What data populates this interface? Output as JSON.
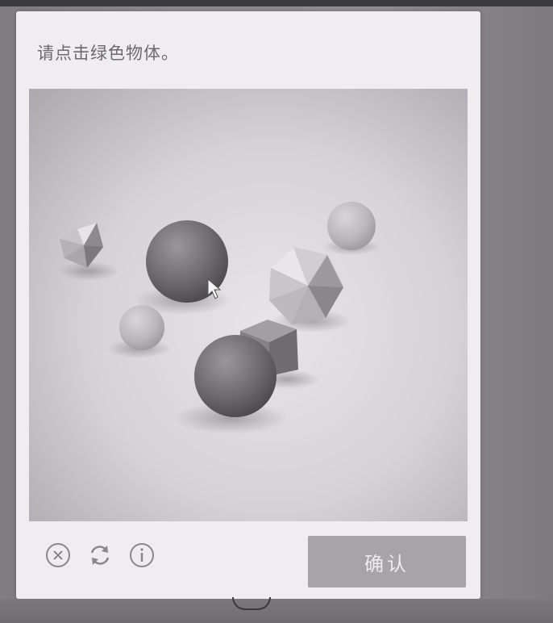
{
  "captcha": {
    "prompt": "请点击绿色物体。",
    "confirm_label": "确认"
  },
  "controls": {
    "close_icon": "close-circle-icon",
    "refresh_icon": "refresh-icon",
    "info_icon": "info-icon"
  },
  "scene": {
    "objects": [
      {
        "shape": "icosahedron",
        "size": "small"
      },
      {
        "shape": "sphere",
        "size": "large"
      },
      {
        "shape": "sphere",
        "size": "small"
      },
      {
        "shape": "icosahedron",
        "size": "medium"
      },
      {
        "shape": "sphere",
        "size": "medium"
      },
      {
        "shape": "cube",
        "size": "small"
      },
      {
        "shape": "sphere",
        "size": "large"
      }
    ]
  }
}
